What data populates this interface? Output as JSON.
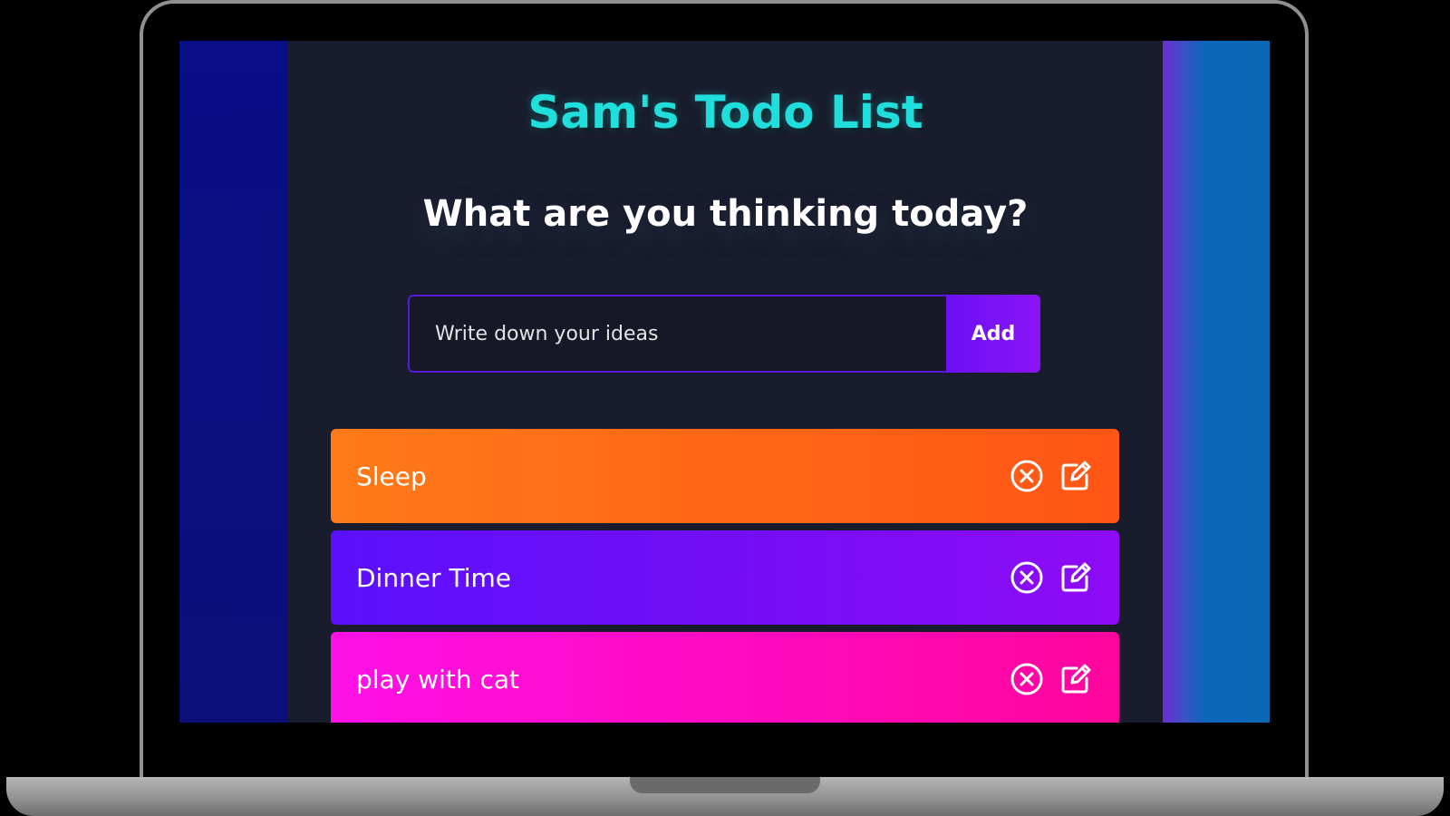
{
  "app": {
    "title": "Sam's Todo List",
    "question": "What are you thinking today?"
  },
  "form": {
    "placeholder": "Write down your ideas",
    "value": "",
    "add_label": "Add"
  },
  "todos": [
    {
      "text": "Sleep",
      "color": "#ff6a16"
    },
    {
      "text": "Dinner Time",
      "color": "#7a0ef8"
    },
    {
      "text": "play with cat",
      "color": "#ff0bc4"
    }
  ],
  "icons": {
    "delete": "close-circle-icon",
    "edit": "edit-icon"
  },
  "colors": {
    "title": "#1fdedb",
    "background": "#191c2d",
    "accent": "#6a10f4"
  }
}
